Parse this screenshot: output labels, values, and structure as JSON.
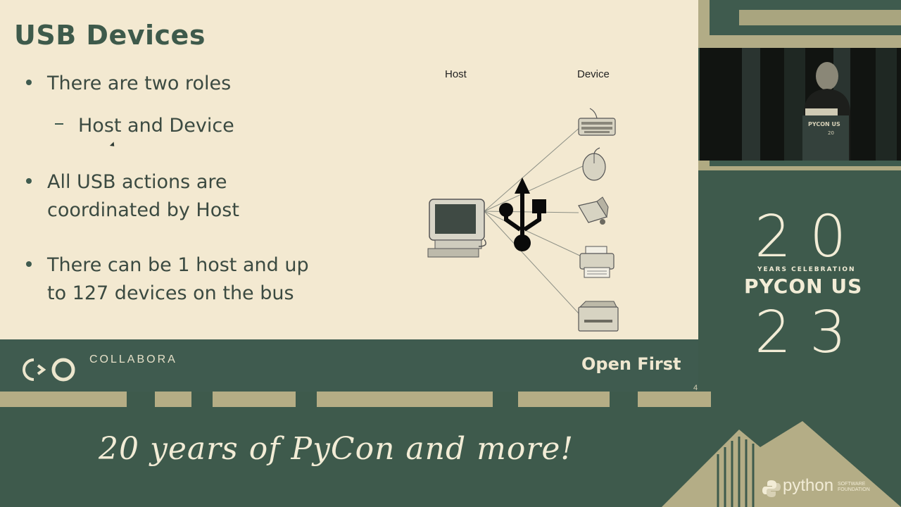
{
  "slide": {
    "title": "USB Devices",
    "bullets": [
      "There are two roles",
      "All USB actions are",
      "coordinated by Host",
      "There can be 1 host and up",
      "to 127 devices on the bus"
    ],
    "sub_bullet": "Host and Device",
    "diagram": {
      "host_label": "Host",
      "device_label": "Device",
      "devices": [
        "keyboard-icon",
        "mouse-icon",
        "usb-stick-icon",
        "printer-icon",
        "disk-drive-icon"
      ]
    },
    "footer": {
      "brand": "COLLABORA",
      "slogan": "Open First",
      "page_number": "4"
    }
  },
  "badge": {
    "year_top": "20",
    "subtitle": "YEARS CELEBRATION",
    "event": "PYCON US",
    "year_bottom": "23"
  },
  "banner": {
    "tagline": "20 years of PyCon and more!",
    "sponsor": "python",
    "sponsor_sub_1": "SOFTWARE",
    "sponsor_sub_2": "FOUNDATION"
  },
  "colors": {
    "slide_bg": "#f3e9d1",
    "brand_green": "#3f5b4f",
    "cream": "#f2ecd6",
    "khaki": "#b5ad85"
  }
}
